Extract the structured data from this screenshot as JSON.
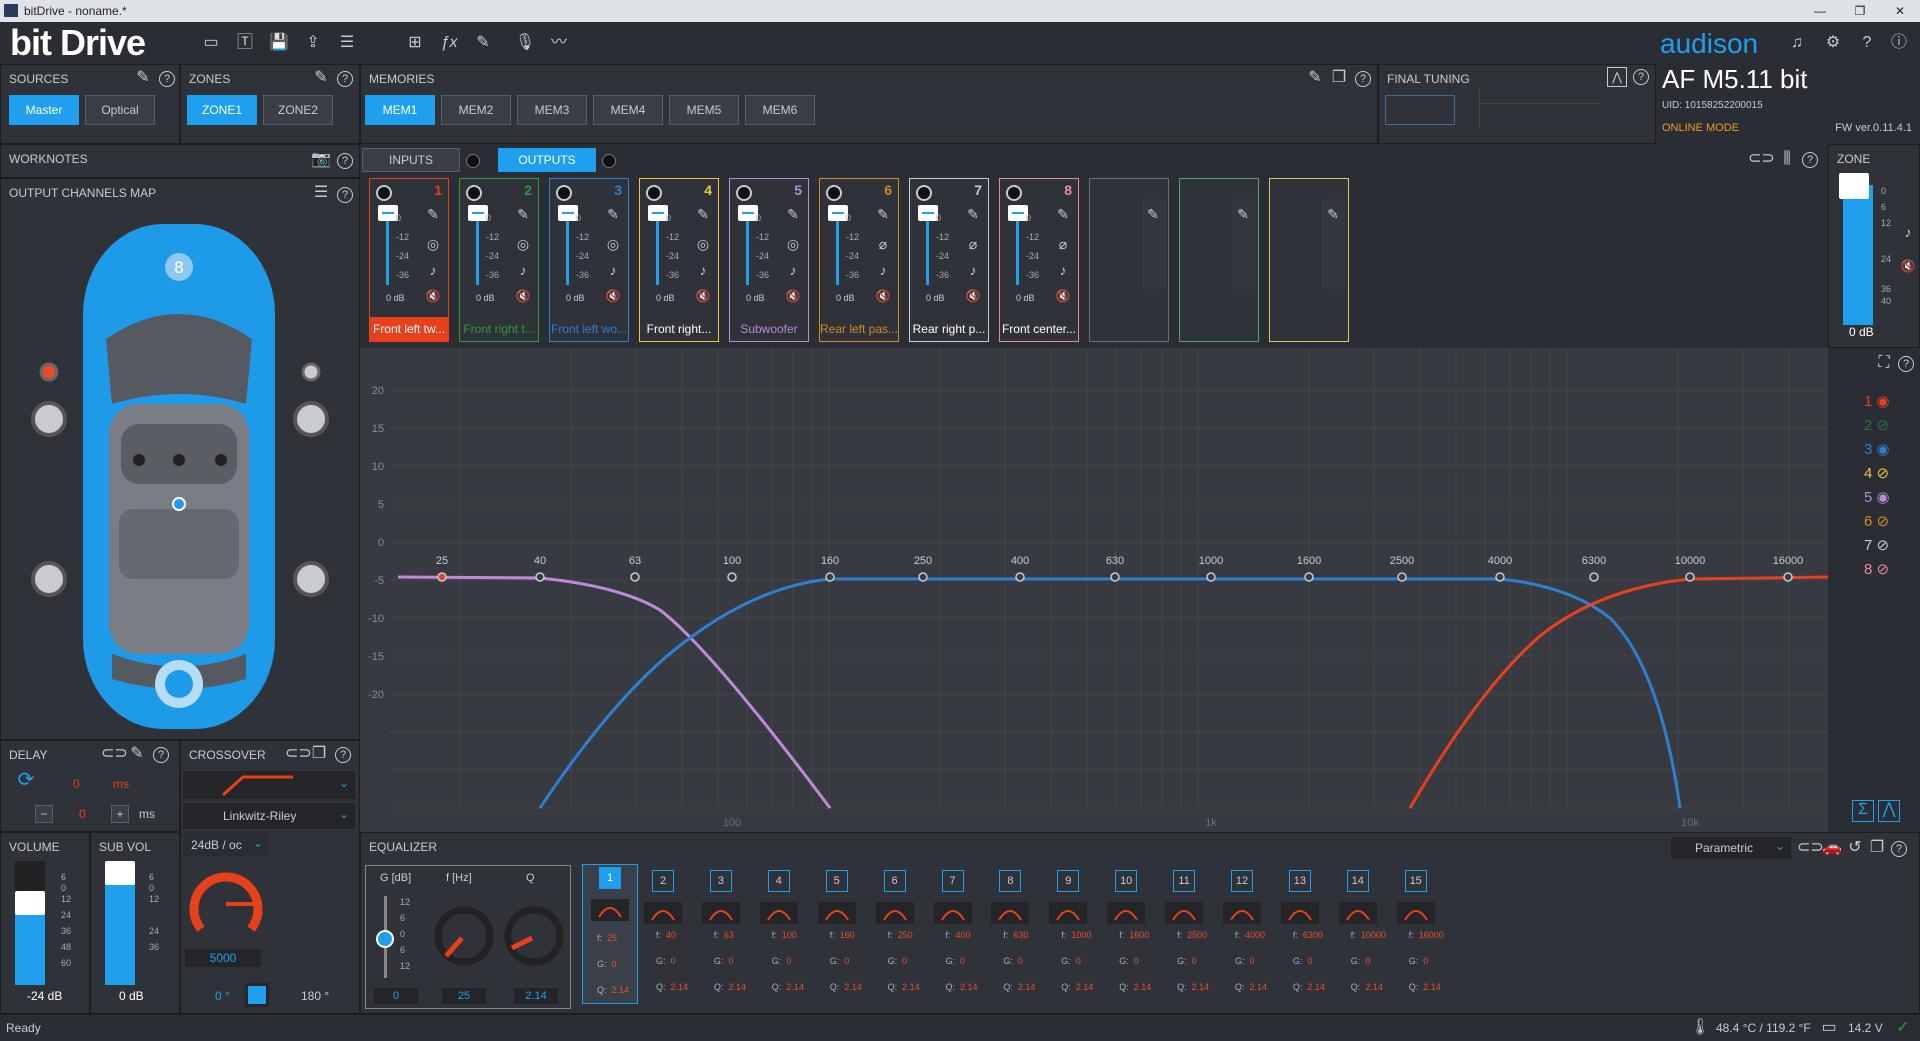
{
  "window": {
    "title": "bitDrive - noname.*",
    "icon": "app-icon"
  },
  "brand": {
    "logo_text": "bit Drive",
    "vendor": "audison"
  },
  "device": {
    "name": "AF M5.11 bit",
    "uid": "UID: 10158252200015",
    "mode": "ONLINE MODE",
    "fw": "FW ver.0.11.4.1"
  },
  "sources": {
    "title": "SOURCES",
    "items": [
      "Master",
      "Optical"
    ],
    "active": 0
  },
  "zones": {
    "title": "ZONES",
    "items": [
      "ZONE1",
      "ZONE2"
    ],
    "active": 0
  },
  "memories": {
    "title": "MEMORIES",
    "items": [
      "MEM1",
      "MEM2",
      "MEM3",
      "MEM4",
      "MEM5",
      "MEM6"
    ],
    "active": 0
  },
  "final_tuning": {
    "title": "FINAL TUNING"
  },
  "worknotes": {
    "title": "WORKNOTES"
  },
  "channels_map": {
    "title": "OUTPUT CHANNELS MAP"
  },
  "io_tabs": {
    "inputs": "INPUTS",
    "outputs": "OUTPUTS",
    "active": "outputs"
  },
  "channels": [
    {
      "num": "1",
      "label": "Front left tw...",
      "color": "#e8401c",
      "db": "0 dB",
      "active": true,
      "scale": [
        "0",
        "-12",
        "-24",
        "-36"
      ]
    },
    {
      "num": "2",
      "label": "Front right t...",
      "color": "#2f9a3a",
      "db": "0 dB",
      "active": false,
      "scale": [
        "0",
        "-12",
        "-24",
        "-36"
      ]
    },
    {
      "num": "3",
      "label": "Front left wo...",
      "color": "#2f7fd0",
      "db": "0 dB",
      "active": false,
      "scale": [
        "0",
        "-12",
        "-24",
        "-36"
      ]
    },
    {
      "num": "4",
      "label": "Front right...",
      "color": "#f0c040",
      "db": "0 dB",
      "active": false,
      "scale": [
        "0",
        "-12",
        "-24",
        "-36"
      ]
    },
    {
      "num": "5",
      "label": "Subwoofer",
      "color": "#b88ad8",
      "db": "0 dB",
      "active": false,
      "scale": [
        "0",
        "-12",
        "-24",
        "-36"
      ]
    },
    {
      "num": "6",
      "label": "Rear left pas...",
      "color": "#d08a28",
      "db": "0 dB",
      "active": false,
      "scale": [
        "0",
        "-12",
        "-24",
        "-36"
      ]
    },
    {
      "num": "7",
      "label": "Rear right p...",
      "color": "#c8ccd2",
      "db": "0 dB",
      "active": false,
      "scale": [
        "0",
        "-12",
        "-24",
        "-36"
      ]
    },
    {
      "num": "8",
      "label": "Front center...",
      "color": "#e88aa0",
      "db": "0 dB",
      "active": false,
      "scale": [
        "0",
        "-12",
        "-24",
        "-36"
      ]
    }
  ],
  "empty_channels": [
    {
      "color": "#6a6e75"
    },
    {
      "color": "#4aa870"
    },
    {
      "color": "#d8c860"
    }
  ],
  "zone": {
    "title": "ZONE",
    "db": "0 dB",
    "scale": [
      "0",
      "6",
      "12",
      "24",
      "36",
      "40"
    ]
  },
  "graph": {
    "y_ticks": [
      "20",
      "15",
      "10",
      "5",
      "0",
      "-5",
      "-10",
      "-15",
      "-20"
    ],
    "freq_labels": [
      "25",
      "40",
      "63",
      "100",
      "160",
      "250",
      "400",
      "630",
      "1000",
      "1600",
      "2500",
      "4000",
      "6300",
      "10000",
      "16000"
    ],
    "decade_labels": [
      "100",
      "1k",
      "10k"
    ],
    "legend": [
      "1",
      "2",
      "3",
      "4",
      "5",
      "6",
      "7",
      "8"
    ]
  },
  "delay": {
    "title": "DELAY",
    "value1": "0",
    "unit1": "ms",
    "value2": "0",
    "unit2": "ms"
  },
  "crossover": {
    "title": "CROSSOVER",
    "filter": "Linkwitz-Riley",
    "slope": "24dB / oc",
    "freq": "5000",
    "phase_min": "0 °",
    "phase_max": "180 °"
  },
  "volume": {
    "title": "VOLUME",
    "db": "-24 dB",
    "scale": [
      "6",
      "0",
      "12",
      "24",
      "36",
      "48",
      "60"
    ]
  },
  "sub_vol": {
    "title": "SUB VOL",
    "db": "0 dB",
    "scale": [
      "6",
      "0",
      "12",
      "24",
      "36"
    ]
  },
  "equalizer": {
    "title": "EQUALIZER",
    "mode": "Parametric",
    "headers": [
      "G [dB]",
      "f [Hz]",
      "Q"
    ],
    "scale": [
      "12",
      "6",
      "0",
      "6",
      "12"
    ],
    "gain": "0",
    "freq": "25",
    "q": "2.14",
    "bands": [
      {
        "n": "1",
        "f": "25",
        "g": "0",
        "q": "2.14"
      },
      {
        "n": "2",
        "f": "40",
        "g": "0",
        "q": "2.14"
      },
      {
        "n": "3",
        "f": "63",
        "g": "0",
        "q": "2.14"
      },
      {
        "n": "4",
        "f": "100",
        "g": "0",
        "q": "2.14"
      },
      {
        "n": "5",
        "f": "160",
        "g": "0",
        "q": "2.14"
      },
      {
        "n": "6",
        "f": "250",
        "g": "0",
        "q": "2.14"
      },
      {
        "n": "7",
        "f": "400",
        "g": "0",
        "q": "2.14"
      },
      {
        "n": "8",
        "f": "630",
        "g": "0",
        "q": "2.14"
      },
      {
        "n": "9",
        "f": "1000",
        "g": "0",
        "q": "2.14"
      },
      {
        "n": "10",
        "f": "1600",
        "g": "0",
        "q": "2.14"
      },
      {
        "n": "11",
        "f": "2500",
        "g": "0",
        "q": "2.14"
      },
      {
        "n": "12",
        "f": "4000",
        "g": "0",
        "q": "2.14"
      },
      {
        "n": "13",
        "f": "6300",
        "g": "0",
        "q": "2.14"
      },
      {
        "n": "14",
        "f": "10000",
        "g": "0",
        "q": "2.14"
      },
      {
        "n": "15",
        "f": "16000",
        "g": "0",
        "q": "2.14"
      }
    ],
    "labels": {
      "f": "f:",
      "g": "G:",
      "q": "Q:"
    }
  },
  "status": {
    "text": "Ready",
    "temp": "48.4 °C / 119.2 °F",
    "voltage": "14.2 V"
  }
}
